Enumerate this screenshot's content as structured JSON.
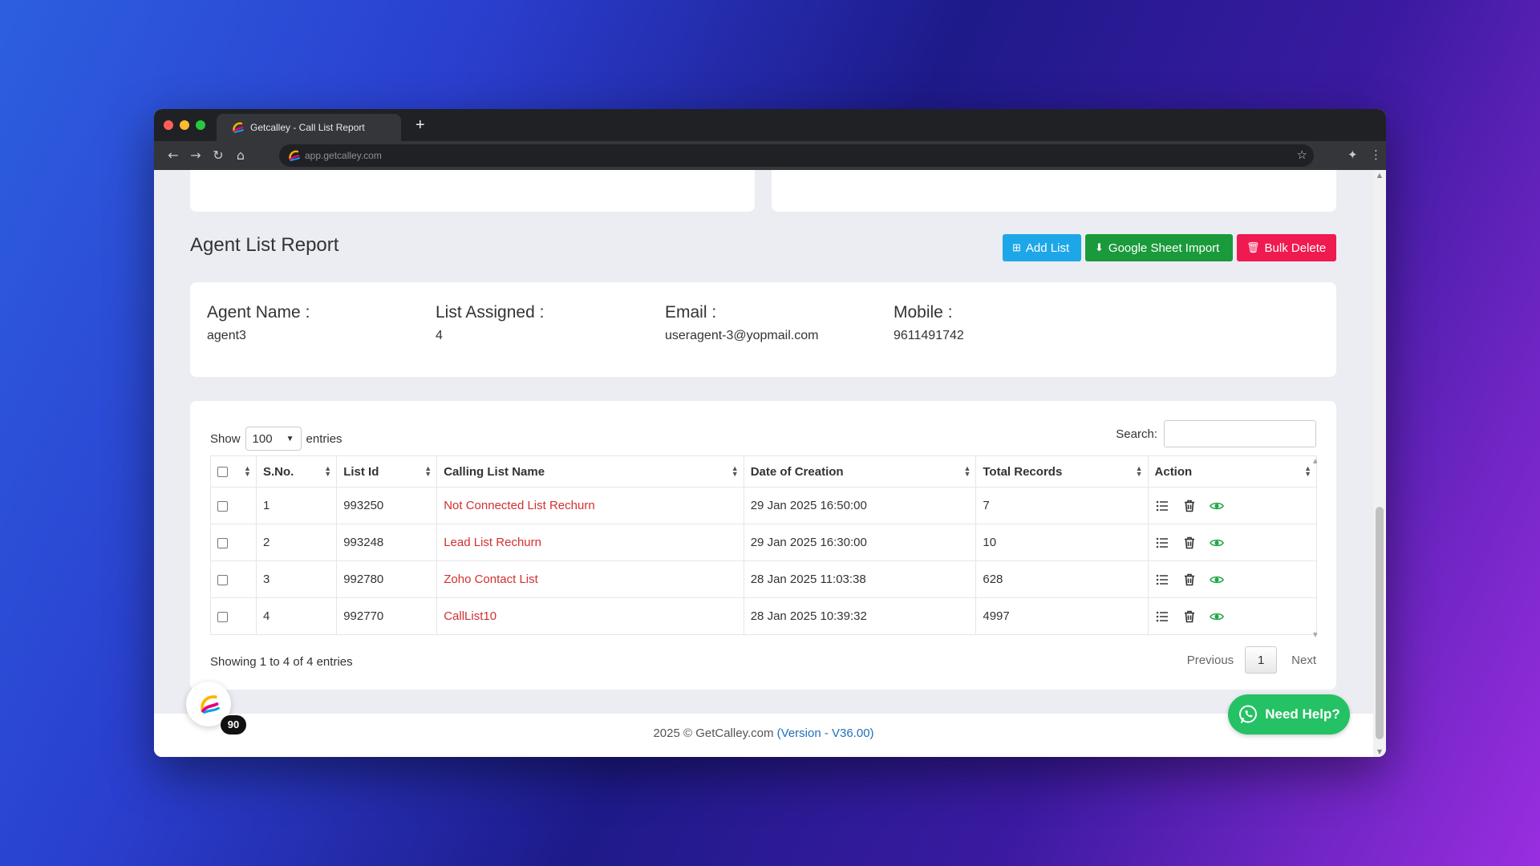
{
  "browser": {
    "tab_title": "Getcalley - Call List Report",
    "new_tab": "+",
    "url": "app.getcalley.com"
  },
  "page": {
    "title": "Agent List Report",
    "buttons": {
      "add_list": "Add List",
      "google_sheet_import": "Google Sheet Import",
      "bulk_delete": "Bulk Delete"
    }
  },
  "agent": {
    "name_label": "Agent Name :",
    "name": "agent3",
    "list_label": "List Assigned :",
    "list_count": "4",
    "email_label": "Email :",
    "email": "useragent-3@yopmail.com",
    "mobile_label": "Mobile :",
    "mobile": "9611491742"
  },
  "table": {
    "show_label": "Show",
    "entries_value": "100",
    "entries_label": "entries",
    "search_label": "Search:",
    "search_value": "",
    "columns": [
      "S.No.",
      "List Id",
      "Calling List Name",
      "Date of Creation",
      "Total Records",
      "Action"
    ],
    "rows": [
      {
        "sno": "1",
        "list_id": "993250",
        "name": "Not Connected List Rechurn",
        "date": "29 Jan 2025 16:50:00",
        "total": "7"
      },
      {
        "sno": "2",
        "list_id": "993248",
        "name": "Lead List Rechurn",
        "date": "29 Jan 2025 16:30:00",
        "total": "10"
      },
      {
        "sno": "3",
        "list_id": "992780",
        "name": "Zoho Contact List",
        "date": "28 Jan 2025 11:03:38",
        "total": "628"
      },
      {
        "sno": "4",
        "list_id": "992770",
        "name": "CallList10",
        "date": "28 Jan 2025 10:39:32",
        "total": "4997"
      }
    ],
    "showing": "Showing 1 to 4 of 4 entries",
    "pager": {
      "previous": "Previous",
      "page": "1",
      "next": "Next"
    }
  },
  "footer": {
    "copyright": "2025 © GetCalley.com ",
    "version": "(Version - V36.00)"
  },
  "widget": {
    "badge": "90"
  },
  "help": {
    "label": "Need Help?"
  },
  "colors": {
    "add_list": "#1ea7e8",
    "google_sheet": "#1a9a3a",
    "bulk_delete": "#ef1a50",
    "list_link": "#d23030",
    "view_icon": "#22a64a",
    "help_button": "#25c165"
  }
}
